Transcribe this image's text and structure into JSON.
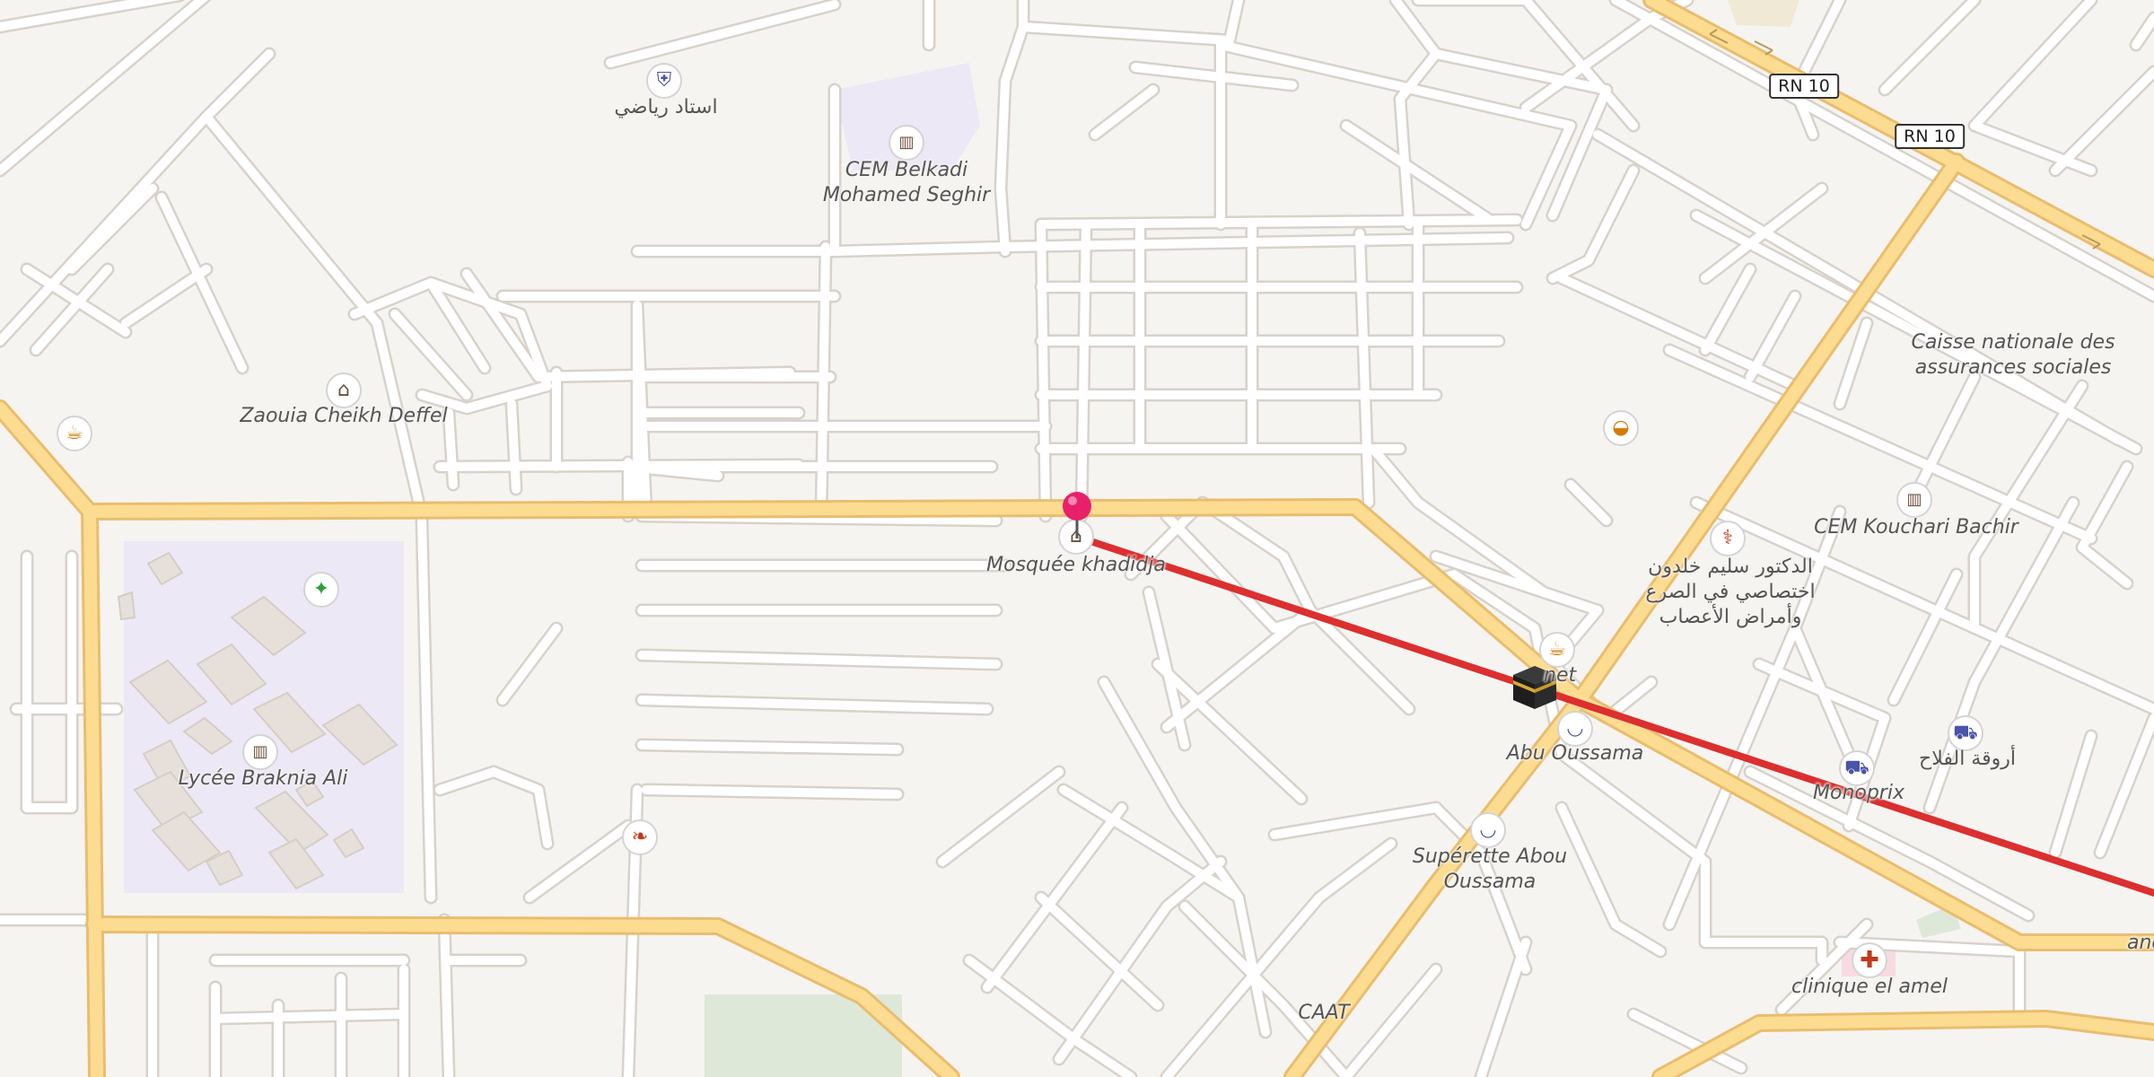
{
  "map": {
    "colors": {
      "background": "#f6f4f1",
      "street_fill": "#ffffff",
      "street_casing": "#d8d2cb",
      "primary_fill": "#fbdc91",
      "primary_casing": "#e9bd6f",
      "route": "#dc2f2f",
      "campus": "#ece8f6",
      "building": "#e7e0da",
      "park": "#dde8d9",
      "pin": "#e8206b"
    },
    "road_shields": [
      "RN 10",
      "RN 10"
    ],
    "labels": {
      "stade": "استاد رياضي",
      "cem_belkadi_1": "CEM Belkadi",
      "cem_belkadi_2": "Mohamed Seghir",
      "zaouia": "Zaouia Cheikh Deffel",
      "lycee": "Lycée Braknia Ali",
      "mosquee": "Mosquée khadidja",
      "caisse_1": "Caisse nationale des",
      "caisse_2": "assurances sociales",
      "cem_kouchari": "CEM Kouchari Bachir",
      "doctor_1": "الدكتور سليم خلدون",
      "doctor_2": "اختصاصي في الصرع",
      "doctor_3": "وأمراض الأعصاب",
      "cafe_partial": "net",
      "abu_oussama": "Abu Oussama",
      "superette_1": "Supérette Abou",
      "superette_2": "Oussama",
      "monoprix": "Monoprix",
      "arwiqat": "أروقة الفلاح",
      "clinique": "clinique el amel",
      "caat": "CAAT",
      "edge_partial": "and"
    },
    "icons": {
      "stadium": "stadium-icon",
      "school": "school-icon",
      "mosque": "mosque-icon",
      "cafe": "cafe-icon",
      "sports": "sports-icon",
      "veterinary": "veterinary-icon",
      "bakery": "bakery-icon",
      "doctor": "doctor-icon",
      "shop": "shop-icon",
      "supermarket": "supermarket-icon",
      "clinic": "clinic-icon",
      "qibla": "kaaba-icon",
      "location_pin": "location-pin-icon"
    }
  }
}
